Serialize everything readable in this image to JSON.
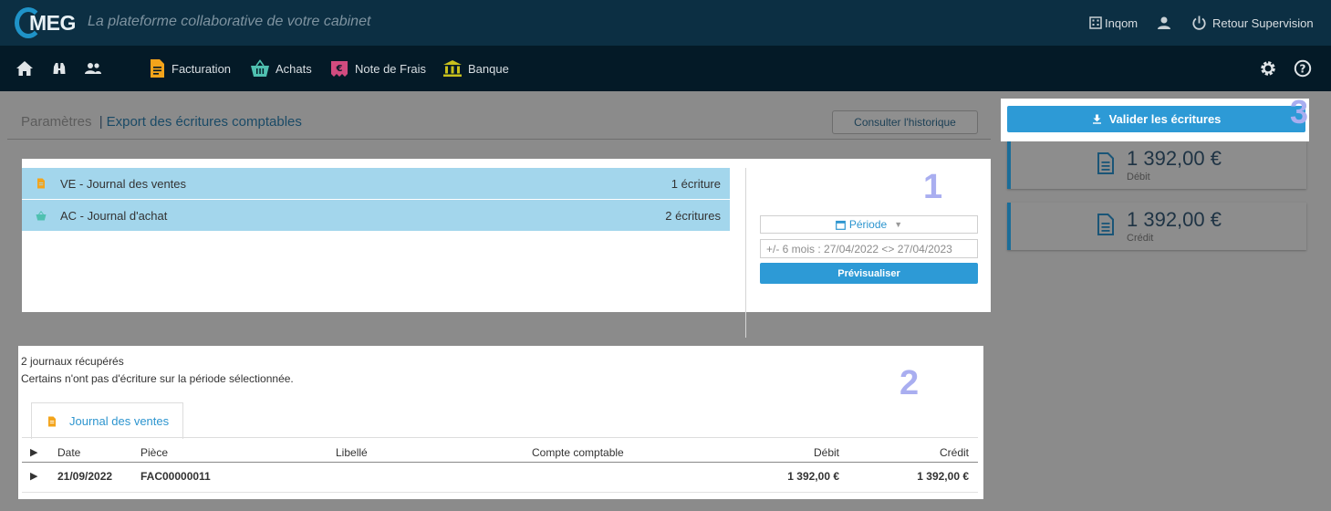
{
  "header": {
    "logo_text": "MEG",
    "tagline": "La plateforme collaborative de votre cabinet",
    "company": "Inqom",
    "retour": "Retour Supervision"
  },
  "nav": {
    "items": [
      {
        "label": "Facturation",
        "icon": "document-icon"
      },
      {
        "label": "Achats",
        "icon": "basket-icon"
      },
      {
        "label": "Note de Frais",
        "icon": "receipt-icon"
      },
      {
        "label": "Banque",
        "icon": "bank-icon"
      }
    ]
  },
  "breadcrumb": {
    "parent": "Paramètres",
    "separator": "|",
    "current": "Export des écritures comptables"
  },
  "historique_label": "Consulter l'historique",
  "journals": [
    {
      "label": "VE - Journal des ventes",
      "count": "1 écriture",
      "icon": "document-icon"
    },
    {
      "label": "AC - Journal d'achat",
      "count": "2 écritures",
      "icon": "basket-icon"
    }
  ],
  "periode": {
    "label": "Période",
    "range": "+/- 6 mois : 27/04/2022 <> 27/04/2023",
    "preview_button": "Prévisualiser"
  },
  "markers": {
    "one": "1",
    "two": "2",
    "three": "3"
  },
  "results": {
    "line1": "2 journaux récupérés",
    "line2": "Certains n'ont pas d'écriture sur la période sélectionnée.",
    "tab_label": "Journal des ventes",
    "headers": {
      "date": "Date",
      "piece": "Pièce",
      "libelle": "Libellé",
      "compte": "Compte comptable",
      "debit": "Débit",
      "credit": "Crédit"
    },
    "row": {
      "date": "21/09/2022",
      "piece": "FAC00000011",
      "libelle": "",
      "compte": "",
      "debit": "1 392,00 €",
      "credit": "1 392,00 €"
    }
  },
  "valider_label": "Valider les écritures",
  "totals": [
    {
      "amount": "1 392,00 €",
      "label": "Débit"
    },
    {
      "amount": "1 392,00 €",
      "label": "Crédit"
    }
  ],
  "colors": {
    "accent": "#2d9ad6",
    "topbar": "#0c2f43",
    "navbar": "#041a27",
    "row_highlight": "#a3d6ec",
    "marker": "#a9aef0"
  }
}
